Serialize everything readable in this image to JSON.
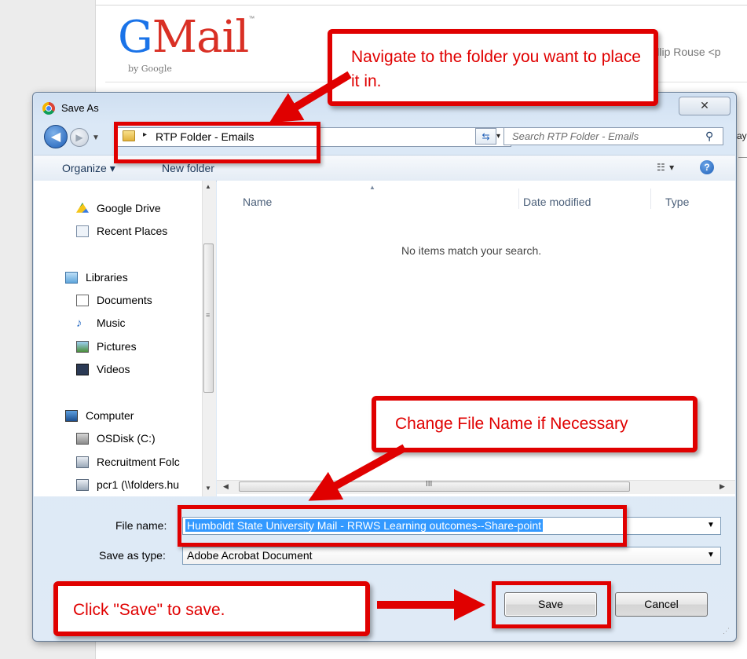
{
  "gmail": {
    "logo_g": "G",
    "logo_rest": "Mail",
    "logo_tm": "™",
    "by_google": "by Google",
    "user_text": "Phillip Rouse <p",
    "partial_text": "ay"
  },
  "dialog": {
    "title": "Save As",
    "close_label": "✕",
    "back_icon": "back-arrow-icon",
    "forward_icon": "forward-arrow-icon"
  },
  "address": {
    "crumb_sep": "▸",
    "folder": "RTP Folder - Emails",
    "dropdown": "▾",
    "refresh": "⇆",
    "search_placeholder": "Search RTP Folder - Emails",
    "search_glyph": "⚲"
  },
  "toolbar": {
    "organize_label": "Organize ▾",
    "new_folder_label": "New folder",
    "view_label": "☷ ▾",
    "help_label": "?"
  },
  "nav": {
    "items": [
      {
        "label": "Google Drive",
        "icon": "google-drive-icon"
      },
      {
        "label": "Recent Places",
        "icon": "recent-places-icon"
      },
      {
        "label": "Libraries",
        "icon": "libraries-icon"
      },
      {
        "label": "Documents",
        "icon": "documents-icon"
      },
      {
        "label": "Music",
        "icon": "music-icon"
      },
      {
        "label": "Pictures",
        "icon": "pictures-icon"
      },
      {
        "label": "Videos",
        "icon": "videos-icon"
      },
      {
        "label": "Computer",
        "icon": "computer-icon"
      },
      {
        "label": "OSDisk (C:)",
        "icon": "disk-icon"
      },
      {
        "label": "Recruitment Folc",
        "icon": "network-drive-icon"
      },
      {
        "label": "pcr1 (\\\\folders.hu",
        "icon": "network-drive-icon"
      }
    ]
  },
  "file_list": {
    "columns": [
      "Name",
      "Date modified",
      "Type"
    ],
    "empty_message": "No items match your search.",
    "scroll_grip": "III"
  },
  "form": {
    "file_name_label": "File name:",
    "file_name_value": "Humboldt State University Mail - RRWS Learning outcomes--Share-point",
    "save_type_label": "Save as type:",
    "save_type_value": "Adobe Acrobat Document",
    "save_label": "Save",
    "cancel_label": "Cancel"
  },
  "annotations": {
    "navigate": "Navigate to the folder you want to place it in.",
    "change_name": "Change File Name if Necessary",
    "click_save": "Click \"Save\" to save."
  },
  "colors": {
    "annotation_red": "#e00000",
    "selection_blue": "#3399ff",
    "dialog_chrome": "#d9e6f4"
  }
}
